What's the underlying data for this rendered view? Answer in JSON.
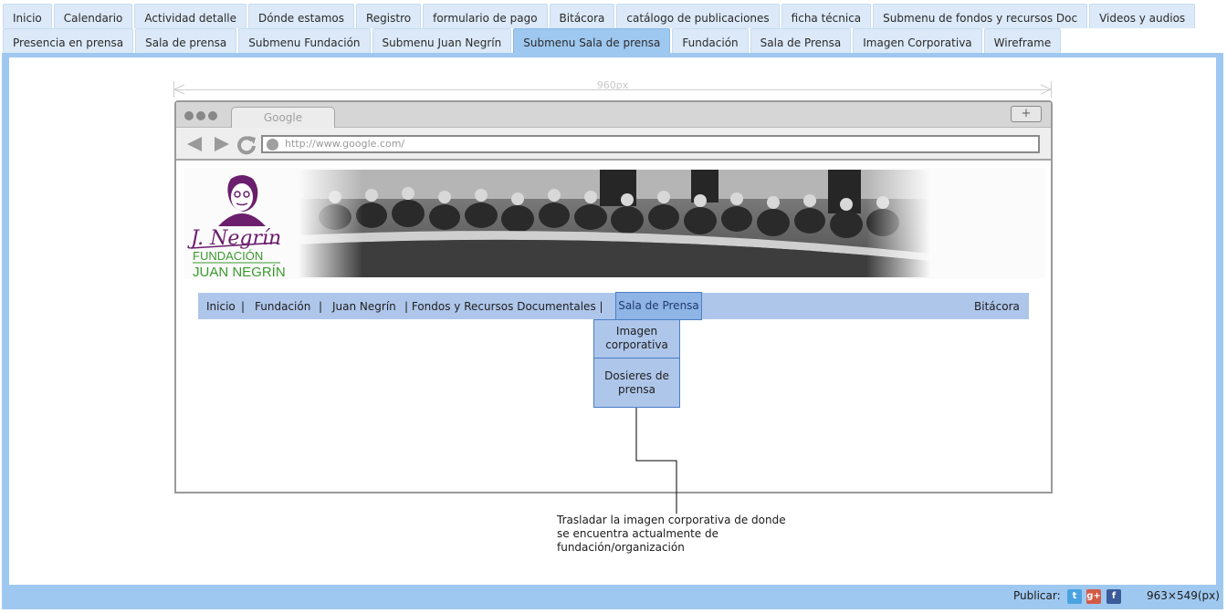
{
  "tabs_row1": [
    "Inicio",
    "Calendario",
    "Actividad detalle",
    "Dónde estamos",
    "Registro",
    "formulario de pago",
    "Bitácora",
    "catálogo de publicaciones",
    "ficha técnica",
    "Submenu de fondos y recursos Doc",
    "Videos y audios"
  ],
  "tabs_row2": [
    "Presencia en prensa",
    "Sala de prensa",
    "Submenu Fundación",
    "Submenu Juan Negrín",
    "Submenu Sala de prensa",
    "Fundación",
    "Sala de Prensa",
    "Imagen Corporativa",
    "Wireframe"
  ],
  "active_tab": "Submenu Sala de prensa",
  "ruler": {
    "label": "960px"
  },
  "browser": {
    "tab_label": "Google",
    "new_tab": "+",
    "url": "http://www.google.com/",
    "back_icon": "back-arrow-icon",
    "forward_icon": "forward-arrow-icon",
    "reload_icon": "reload-icon"
  },
  "header": {
    "logo_signature": "J. Negrín",
    "logo_line1": "FUNDACIÓN",
    "logo_line2": "JUAN NEGRÍN"
  },
  "site_nav": {
    "inicio": "Inicio",
    "sep1": "|",
    "fundacion": "Fundación",
    "sep2": "|",
    "juan_negrin": "Juan Negrín",
    "fondos": "| Fondos y Recursos Documentales |",
    "sala_prensa": "Sala de Prensa",
    "bitacora": "Bitácora"
  },
  "dropdown": [
    "Imagen corporativa",
    "Dosieres de prensa"
  ],
  "annotation": "Trasladar la imagen corporativa de donde se encuentra actualmente de fundación/organización",
  "footer": {
    "publish_label": "Publicar:",
    "dims": "963×549(px)",
    "icons": [
      "twitter-icon",
      "google-plus-icon",
      "facebook-icon"
    ]
  },
  "colors": {
    "frame": "#9fc8f0",
    "nav": "#aec6ea",
    "nav_selected": "#8fb4e6",
    "logo_purple": "#6b1e6e",
    "logo_green": "#3a9a2e"
  }
}
